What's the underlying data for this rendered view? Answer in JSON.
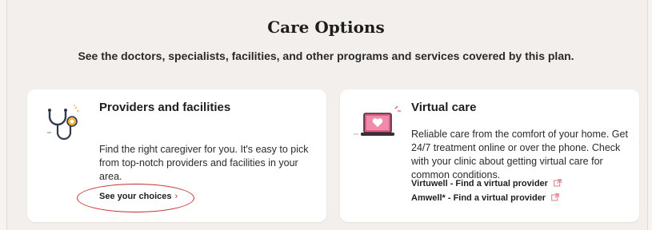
{
  "header": {
    "title": "Care Options",
    "subtitle": "See the doctors, specialists, facilities, and other programs and services covered by this plan."
  },
  "cards": [
    {
      "title": "Providers and facilities",
      "body": "Find the right caregiver for you. It's easy to pick from top-notch providers and facilities in your area.",
      "link": "See your choices",
      "icon": "stethoscope-icon"
    },
    {
      "title": "Virtual care",
      "body": "Reliable care from the comfort of your home. Get 24/7 treatment online or over the phone. Check with your clinic about getting virtual care for common conditions.",
      "links": [
        "Virtuwell - Find a virtual provider",
        "Amwell* - Find a virtual provider"
      ],
      "icon": "laptop-heart-icon"
    }
  ],
  "colors": {
    "accent": "#c62828",
    "background": "#f3efec",
    "card": "#ffffff"
  }
}
